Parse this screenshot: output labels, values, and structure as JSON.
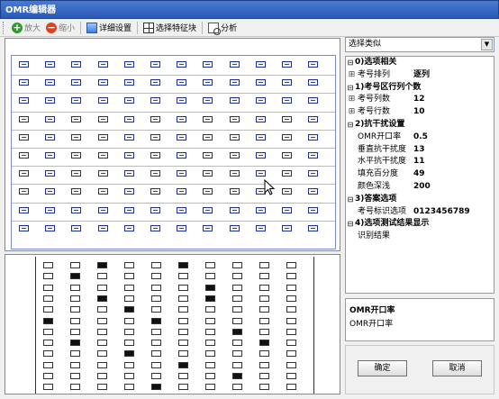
{
  "window": {
    "title": "OMR编辑器"
  },
  "toolbar": {
    "zoom_in": "放大",
    "zoom_out": "缩小",
    "detail_settings": "详细设置",
    "select_feature": "选择特征块",
    "analyze": "分析"
  },
  "combo": {
    "value": "选择类似"
  },
  "properties": [
    {
      "kind": "cat",
      "label": "0)选项相关"
    },
    {
      "kind": "prop",
      "name": "考号排列",
      "value": "逐列",
      "expand": true
    },
    {
      "kind": "cat",
      "label": "1)考号区行列个数"
    },
    {
      "kind": "prop",
      "name": "考号列数",
      "value": "12",
      "expand": true
    },
    {
      "kind": "prop",
      "name": "考号行数",
      "value": "10",
      "expand": true
    },
    {
      "kind": "cat",
      "label": "2)抗干扰设置"
    },
    {
      "kind": "prop",
      "name": "OMR开口率",
      "value": "0.5"
    },
    {
      "kind": "prop",
      "name": "垂直抗干扰度",
      "value": "13"
    },
    {
      "kind": "prop",
      "name": "水平抗干扰度",
      "value": "11"
    },
    {
      "kind": "prop",
      "name": "填充百分度",
      "value": "49"
    },
    {
      "kind": "prop",
      "name": "颜色深浅",
      "value": "200"
    },
    {
      "kind": "cat",
      "label": "3)答案选项"
    },
    {
      "kind": "prop",
      "name": "考号标识选项",
      "value": "0123456789"
    },
    {
      "kind": "cat",
      "label": "4)选项测试结果显示"
    },
    {
      "kind": "prop",
      "name": "识别结果",
      "value": ""
    }
  ],
  "description": {
    "title": "OMR开口率",
    "text": "OMR开口率"
  },
  "buttons": {
    "ok": "确定",
    "cancel": "取消"
  },
  "colors": {
    "titlebar": "#2a5ab8",
    "bubble_border": "#1a2e9e"
  },
  "top_grid": {
    "columns": 12,
    "rows": 10
  },
  "scan_preview": {
    "rows": 12,
    "columns": 10,
    "filled": [
      [
        0,
        2
      ],
      [
        0,
        5
      ],
      [
        1,
        1
      ],
      [
        2,
        6
      ],
      [
        3,
        2
      ],
      [
        3,
        6
      ],
      [
        4,
        3
      ],
      [
        5,
        0
      ],
      [
        5,
        4
      ],
      [
        6,
        7
      ],
      [
        7,
        1
      ],
      [
        7,
        8
      ],
      [
        8,
        3
      ],
      [
        9,
        5
      ],
      [
        10,
        7
      ],
      [
        11,
        4
      ]
    ]
  }
}
